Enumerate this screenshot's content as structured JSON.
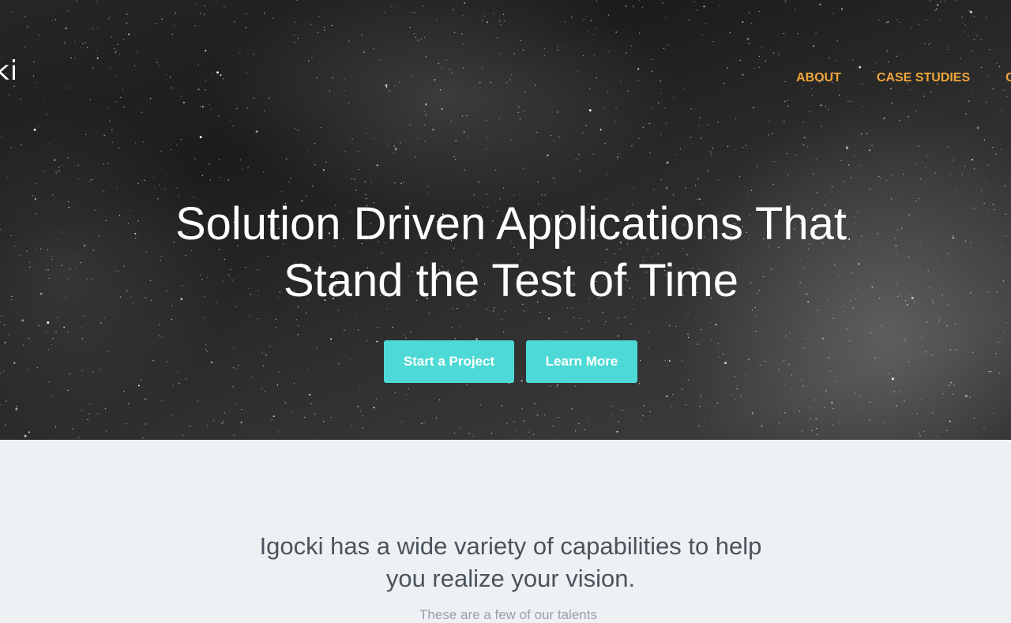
{
  "header": {
    "logo_text": "ki",
    "nav": [
      {
        "label": "ABOUT"
      },
      {
        "label": "CASE STUDIES"
      },
      {
        "label": "C"
      }
    ],
    "nav_color": "#f0a63a"
  },
  "hero": {
    "headline": "Solution Driven Applications That Stand the Test of Time",
    "buttons": {
      "start_project": "Start a Project",
      "learn_more": "Learn More"
    },
    "button_color": "#4dd9d5"
  },
  "capabilities": {
    "heading": "Igocki has a wide variety of capabilities to help you realize your vision.",
    "subheading": "These are a few of our talents"
  }
}
